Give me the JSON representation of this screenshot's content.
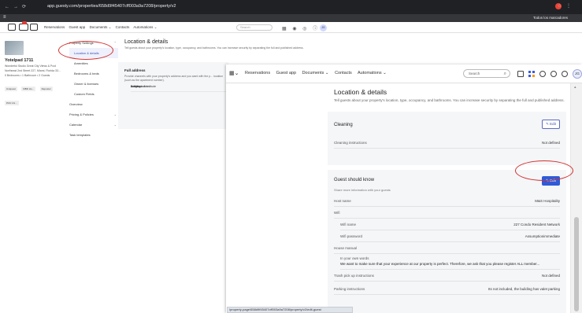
{
  "browser": {
    "url": "app.guesty.com/properties/658d9f45407cff003a9a7208/property/v2",
    "bookmarks_label": "Todos los marcadores"
  },
  "bg_app": {
    "nav": [
      "Reservations",
      "Guest app",
      "Documents ⌄",
      "Contacts",
      "Automations ⌄"
    ],
    "search_placeholder": "Search",
    "avatar_initials": "JG"
  },
  "property": {
    "name": "Yotelpad 1711",
    "subtitle": "Wonderful Studio Great City Views & Pool",
    "address": "Northeast 2nd Street 227, Miami, Florida 33...",
    "specs": "0 Bedrooms • 1 Bathroom • 2 Guests",
    "tags": [
      "Uniquest",
      "MBD Ho...",
      "Reposter",
      "PAS Uni..."
    ]
  },
  "side_menu": [
    {
      "label": "Property Settings",
      "top": true,
      "caret": "⌃"
    },
    {
      "label": "Location & details",
      "selected": true
    },
    {
      "label": "Amenities"
    },
    {
      "label": "Bedrooms & beds"
    },
    {
      "label": "Owner & licenses"
    },
    {
      "label": "Custom Fields"
    },
    {
      "label": "Overview",
      "top": true
    },
    {
      "label": "Pricing & Policies",
      "top": true,
      "caret": "⌄"
    },
    {
      "label": "Calendar",
      "top": true,
      "caret": "⌄"
    },
    {
      "label": "Task templates",
      "top": true
    }
  ],
  "bg_main": {
    "title": "Location & details",
    "desc": "Tell guests about your property's location, type, occupancy, and bathrooms. You can increase security by separating the full and published address.",
    "panel_header": "Full address",
    "panel_text": "Provide channels with your property's address and you want with the p... location (such as the apartment number).",
    "rows": [
      "Address",
      "Building name",
      "Longitude & Latitude"
    ]
  },
  "fg_app": {
    "nav": [
      "Reservations",
      "Guest app",
      "Documents ⌄",
      "Contacts",
      "Automations ⌄"
    ],
    "search_placeholder": "Search",
    "avatar_initials": "JG"
  },
  "location": {
    "title": "Location & details",
    "desc": "Tell guests about your property's location, type, occupancy, and bathrooms. You can increase security by separating the full and published address."
  },
  "cleaning": {
    "title": "Cleaning",
    "edit_label": "Edit",
    "rows": [
      {
        "label": "Cleaning instructions",
        "value": "Not defined"
      }
    ]
  },
  "guest_know": {
    "title": "Guest should know",
    "subtitle": "Share more information with your guests",
    "edit_label": "Edit",
    "host_name_label": "Host name",
    "host_name_value": "M&S Hospitality",
    "wifi_label": "Wifi",
    "wifi_name_label": "Wifi name",
    "wifi_name_value": "227 Condo Resident Network",
    "wifi_password_label": "Wifi password",
    "wifi_password_value": "Assumptionimmediate",
    "house_manual_label": "House manual",
    "own_words_label": "In your own words",
    "own_words_value": "We want to make sure that your experience at our property is perfect. Therefore, we ask that you please register ALL member...",
    "trash_label": "Trash pick up instructions",
    "trash_value": "Not defined",
    "parking_label": "Parking instructions",
    "parking_value": "Its not included, the building has valet parking"
  },
  "status_url": "/property-page/658d9f45407cff003a9a7208/property/v2/edit-guest"
}
